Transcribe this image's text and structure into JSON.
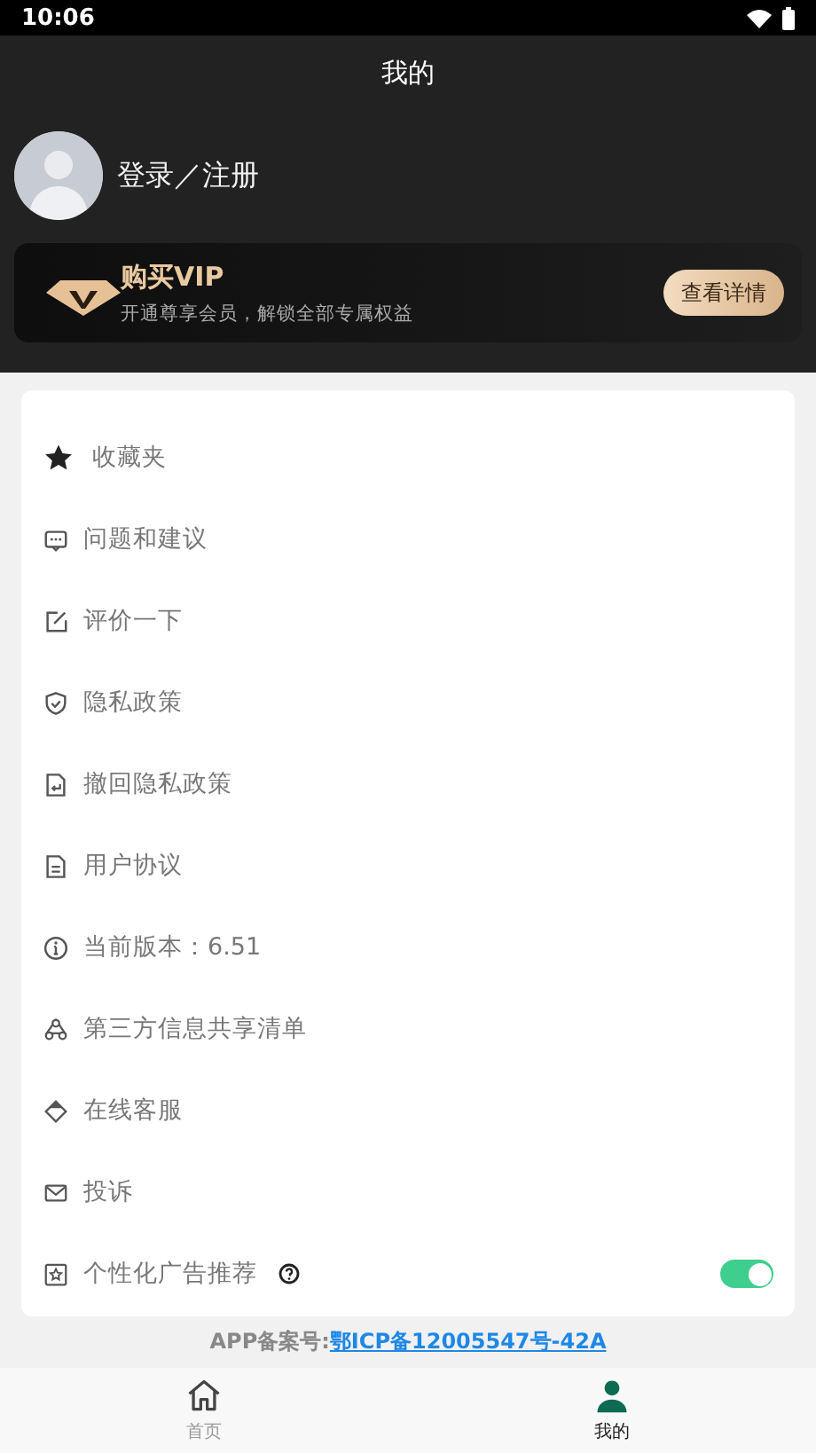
{
  "status_bar": {
    "time": "10:06"
  },
  "header": {
    "title": "我的"
  },
  "profile": {
    "login_label": "登录／注册"
  },
  "vip_card": {
    "title": "购买VIP",
    "subtitle": "开通尊享会员，解锁全部专属权益",
    "button": "查看详情"
  },
  "menu": [
    {
      "kind": "link",
      "label": "收藏夹"
    },
    {
      "kind": "link",
      "label": "问题和建议"
    },
    {
      "kind": "link",
      "label": "评价一下"
    },
    {
      "kind": "link",
      "label": "隐私政策"
    },
    {
      "kind": "link",
      "label": "撤回隐私政策"
    },
    {
      "kind": "link",
      "label": "用户协议"
    },
    {
      "kind": "link",
      "label": "当前版本：6.51"
    },
    {
      "kind": "link",
      "label": "第三方信息共享清单"
    },
    {
      "kind": "link",
      "label": "在线客服"
    },
    {
      "kind": "link",
      "label": "投诉"
    },
    {
      "kind": "toggle",
      "label": "个性化广告推荐",
      "on": true
    }
  ],
  "footer": {
    "label": "APP备案号:",
    "link": "鄂ICP备12005547号-42A"
  },
  "tab_bar": [
    {
      "label": "首页",
      "selected": false
    },
    {
      "label": "我的",
      "selected": true
    }
  ]
}
